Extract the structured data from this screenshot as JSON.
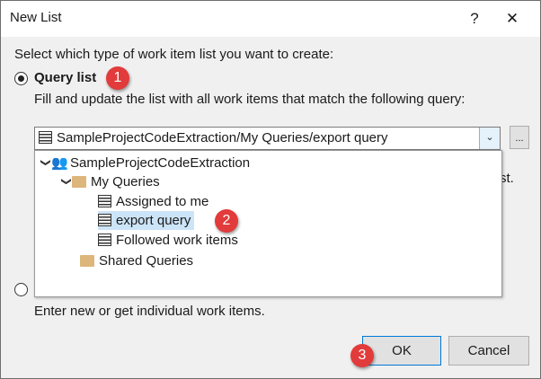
{
  "window": {
    "title": "New List",
    "help": "?",
    "close": "✕"
  },
  "intro": "Select which type of work item list you want to create:",
  "query_option": {
    "label": "Query list",
    "description": "Fill and update the list with all work items that match the following query:",
    "selected": true
  },
  "query_combo": {
    "value": "SampleProjectCodeExtraction/My Queries/export query",
    "ellipsis": "..."
  },
  "tree": {
    "project": "SampleProjectCodeExtraction",
    "my_queries": "My Queries",
    "items": [
      "Assigned to me",
      "export query",
      "Followed work items"
    ],
    "selected": "export query",
    "shared": "Shared Queries"
  },
  "obscured_text": "st.",
  "input_option": {
    "description": "Enter new or get individual work items.",
    "selected": false
  },
  "buttons": {
    "ok": "OK",
    "cancel": "Cancel"
  },
  "badges": [
    "1",
    "2",
    "3"
  ]
}
